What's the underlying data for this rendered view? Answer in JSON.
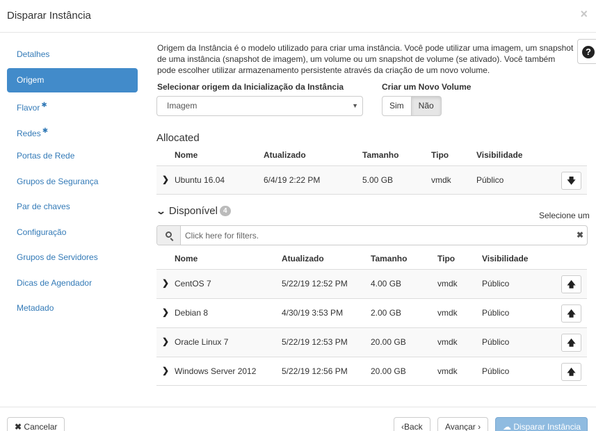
{
  "modal": {
    "title": "Disparar Instância",
    "close_glyph": "×"
  },
  "sidebar": {
    "items": [
      {
        "label": "Detalhes",
        "active": false,
        "required": false
      },
      {
        "label": "Origem",
        "active": true,
        "required": false
      },
      {
        "label": "Flavor",
        "active": false,
        "required": true
      },
      {
        "label": "Redes",
        "active": false,
        "required": true
      },
      {
        "label": "Portas de Rede",
        "active": false,
        "required": false
      },
      {
        "label": "Grupos de Segurança",
        "active": false,
        "required": false
      },
      {
        "label": "Par de chaves",
        "active": false,
        "required": false
      },
      {
        "label": "Configuração",
        "active": false,
        "required": false
      },
      {
        "label": "Grupos de Servidores",
        "active": false,
        "required": false
      },
      {
        "label": "Dicas de Agendador",
        "active": false,
        "required": false
      },
      {
        "label": "Metadado",
        "active": false,
        "required": false
      }
    ]
  },
  "help": {
    "text": "Origem da Instância é o modelo utilizado para criar uma instância. Você pode utilizar uma imagem, um snapshot de uma instância (snapshot de imagem), um volume ou um snapshot de volume (se ativado). Você também pode escolher utilizar armazenamento persistente através da criação de um novo volume.",
    "icon": "question-circle-icon"
  },
  "boot_source": {
    "label": "Selecionar origem da Inicialização da Instância",
    "value": "Imagem"
  },
  "new_volume": {
    "label": "Criar um Novo Volume",
    "options": [
      "Sim",
      "Não"
    ],
    "selected": "Não"
  },
  "allocated": {
    "title": "Allocated",
    "headers": [
      "Nome",
      "Atualizado",
      "Tamanho",
      "Tipo",
      "Visibilidade"
    ],
    "rows": [
      {
        "name": "Ubuntu 16.04",
        "updated": "6/4/19 2:22 PM",
        "size": "5.00 GB",
        "type": "vmdk",
        "visibility": "Público"
      }
    ]
  },
  "available": {
    "title": "Disponível",
    "count": "4",
    "select_hint": "Selecione um",
    "filter_placeholder": "Click here for filters.",
    "headers": [
      "Nome",
      "Atualizado",
      "Tamanho",
      "Tipo",
      "Visibilidade"
    ],
    "rows": [
      {
        "name": "CentOS 7",
        "updated": "5/22/19 12:52 PM",
        "size": "4.00 GB",
        "type": "vmdk",
        "visibility": "Público"
      },
      {
        "name": "Debian 8",
        "updated": "4/30/19 3:53 PM",
        "size": "2.00 GB",
        "type": "vmdk",
        "visibility": "Público"
      },
      {
        "name": "Oracle Linux 7",
        "updated": "5/22/19 12:53 PM",
        "size": "20.00 GB",
        "type": "vmdk",
        "visibility": "Público"
      },
      {
        "name": "Windows Server 2012",
        "updated": "5/22/19 12:56 PM",
        "size": "20.00 GB",
        "type": "vmdk",
        "visibility": "Público"
      }
    ]
  },
  "footer": {
    "cancel_label": "Cancelar",
    "back_label": "Back",
    "next_label": "Avançar",
    "launch_label": "Disparar Instância"
  },
  "colors": {
    "accent": "#428bca",
    "link": "#337ab7",
    "launch_disabled": "#8fbbe0"
  }
}
